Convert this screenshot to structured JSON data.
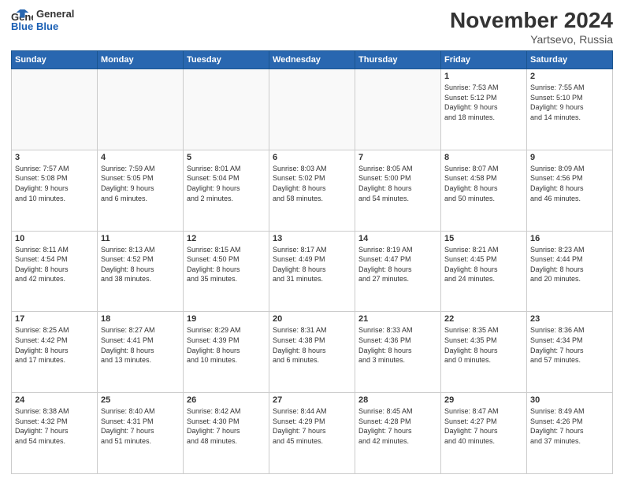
{
  "header": {
    "logo_line1": "General",
    "logo_line2": "Blue",
    "title": "November 2024",
    "subtitle": "Yartsevo, Russia"
  },
  "weekdays": [
    "Sunday",
    "Monday",
    "Tuesday",
    "Wednesday",
    "Thursday",
    "Friday",
    "Saturday"
  ],
  "weeks": [
    [
      {
        "day": "",
        "info": ""
      },
      {
        "day": "",
        "info": ""
      },
      {
        "day": "",
        "info": ""
      },
      {
        "day": "",
        "info": ""
      },
      {
        "day": "",
        "info": ""
      },
      {
        "day": "1",
        "info": "Sunrise: 7:53 AM\nSunset: 5:12 PM\nDaylight: 9 hours\nand 18 minutes."
      },
      {
        "day": "2",
        "info": "Sunrise: 7:55 AM\nSunset: 5:10 PM\nDaylight: 9 hours\nand 14 minutes."
      }
    ],
    [
      {
        "day": "3",
        "info": "Sunrise: 7:57 AM\nSunset: 5:08 PM\nDaylight: 9 hours\nand 10 minutes."
      },
      {
        "day": "4",
        "info": "Sunrise: 7:59 AM\nSunset: 5:05 PM\nDaylight: 9 hours\nand 6 minutes."
      },
      {
        "day": "5",
        "info": "Sunrise: 8:01 AM\nSunset: 5:04 PM\nDaylight: 9 hours\nand 2 minutes."
      },
      {
        "day": "6",
        "info": "Sunrise: 8:03 AM\nSunset: 5:02 PM\nDaylight: 8 hours\nand 58 minutes."
      },
      {
        "day": "7",
        "info": "Sunrise: 8:05 AM\nSunset: 5:00 PM\nDaylight: 8 hours\nand 54 minutes."
      },
      {
        "day": "8",
        "info": "Sunrise: 8:07 AM\nSunset: 4:58 PM\nDaylight: 8 hours\nand 50 minutes."
      },
      {
        "day": "9",
        "info": "Sunrise: 8:09 AM\nSunset: 4:56 PM\nDaylight: 8 hours\nand 46 minutes."
      }
    ],
    [
      {
        "day": "10",
        "info": "Sunrise: 8:11 AM\nSunset: 4:54 PM\nDaylight: 8 hours\nand 42 minutes."
      },
      {
        "day": "11",
        "info": "Sunrise: 8:13 AM\nSunset: 4:52 PM\nDaylight: 8 hours\nand 38 minutes."
      },
      {
        "day": "12",
        "info": "Sunrise: 8:15 AM\nSunset: 4:50 PM\nDaylight: 8 hours\nand 35 minutes."
      },
      {
        "day": "13",
        "info": "Sunrise: 8:17 AM\nSunset: 4:49 PM\nDaylight: 8 hours\nand 31 minutes."
      },
      {
        "day": "14",
        "info": "Sunrise: 8:19 AM\nSunset: 4:47 PM\nDaylight: 8 hours\nand 27 minutes."
      },
      {
        "day": "15",
        "info": "Sunrise: 8:21 AM\nSunset: 4:45 PM\nDaylight: 8 hours\nand 24 minutes."
      },
      {
        "day": "16",
        "info": "Sunrise: 8:23 AM\nSunset: 4:44 PM\nDaylight: 8 hours\nand 20 minutes."
      }
    ],
    [
      {
        "day": "17",
        "info": "Sunrise: 8:25 AM\nSunset: 4:42 PM\nDaylight: 8 hours\nand 17 minutes."
      },
      {
        "day": "18",
        "info": "Sunrise: 8:27 AM\nSunset: 4:41 PM\nDaylight: 8 hours\nand 13 minutes."
      },
      {
        "day": "19",
        "info": "Sunrise: 8:29 AM\nSunset: 4:39 PM\nDaylight: 8 hours\nand 10 minutes."
      },
      {
        "day": "20",
        "info": "Sunrise: 8:31 AM\nSunset: 4:38 PM\nDaylight: 8 hours\nand 6 minutes."
      },
      {
        "day": "21",
        "info": "Sunrise: 8:33 AM\nSunset: 4:36 PM\nDaylight: 8 hours\nand 3 minutes."
      },
      {
        "day": "22",
        "info": "Sunrise: 8:35 AM\nSunset: 4:35 PM\nDaylight: 8 hours\nand 0 minutes."
      },
      {
        "day": "23",
        "info": "Sunrise: 8:36 AM\nSunset: 4:34 PM\nDaylight: 7 hours\nand 57 minutes."
      }
    ],
    [
      {
        "day": "24",
        "info": "Sunrise: 8:38 AM\nSunset: 4:32 PM\nDaylight: 7 hours\nand 54 minutes."
      },
      {
        "day": "25",
        "info": "Sunrise: 8:40 AM\nSunset: 4:31 PM\nDaylight: 7 hours\nand 51 minutes."
      },
      {
        "day": "26",
        "info": "Sunrise: 8:42 AM\nSunset: 4:30 PM\nDaylight: 7 hours\nand 48 minutes."
      },
      {
        "day": "27",
        "info": "Sunrise: 8:44 AM\nSunset: 4:29 PM\nDaylight: 7 hours\nand 45 minutes."
      },
      {
        "day": "28",
        "info": "Sunrise: 8:45 AM\nSunset: 4:28 PM\nDaylight: 7 hours\nand 42 minutes."
      },
      {
        "day": "29",
        "info": "Sunrise: 8:47 AM\nSunset: 4:27 PM\nDaylight: 7 hours\nand 40 minutes."
      },
      {
        "day": "30",
        "info": "Sunrise: 8:49 AM\nSunset: 4:26 PM\nDaylight: 7 hours\nand 37 minutes."
      }
    ]
  ]
}
